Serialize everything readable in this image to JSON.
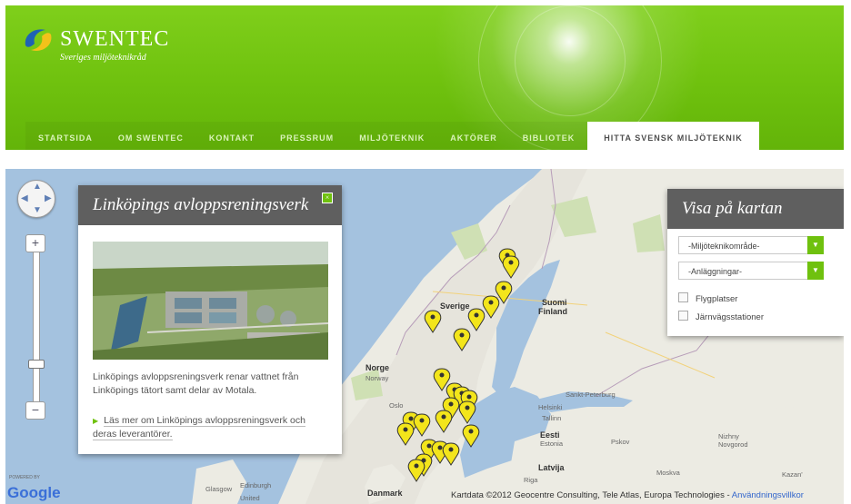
{
  "brand": {
    "name": "SWENTEC",
    "tagline": "Sveriges miljöteknikråd",
    "colors": {
      "green": "#6fc10e",
      "panel_gray": "#5f5f5f",
      "logo_blue": "#1e63b4",
      "logo_yellow": "#f2c21a"
    }
  },
  "nav": {
    "items": [
      {
        "label": "STARTSIDA"
      },
      {
        "label": "OM SWENTEC"
      },
      {
        "label": "KONTAKT"
      },
      {
        "label": "PRESSRUM"
      },
      {
        "label": "MILJÖTEKNIK"
      },
      {
        "label": "AKTÖRER"
      },
      {
        "label": "BIBLIOTEK"
      },
      {
        "label": "HITTA SVENSK MILJÖTEKNIK",
        "active": true
      }
    ]
  },
  "map": {
    "labels": {
      "sverige": "Sverige",
      "suomi": "Suomi",
      "finland": "Finland",
      "norge": "Norge",
      "norway": "Norway",
      "oslo": "Oslo",
      "helsinki": "Helsinki",
      "spb": "Sankt-Peterburg",
      "tallinn": "Tallinn",
      "eesti": "Eesti",
      "estonia": "Estonia",
      "latvija": "Latvija",
      "riga": "Riga",
      "danmark": "Danmark",
      "edinburgh": "Edinburgh",
      "glasgow": "Glasgow",
      "united": "United",
      "moskva": "Moskva",
      "nizhny": "Nizhny Novgorod",
      "kazan": "Kazan'",
      "pskov": "Pskov"
    },
    "google": {
      "powered": "POWERED BY",
      "logo": "Google"
    },
    "attribution": "Kartdata ©2012 Geocentre Consulting, Tele Atlas, Europa Technologies -",
    "attribution_link": "Användningsvillkor"
  },
  "infowindow": {
    "title": "Linköpings avloppsreningsverk",
    "body": "Linköpings avloppsreningsverk renar vattnet från Linköpings tätort samt delar av Motala.",
    "link": "Läs mer om Linköpings avloppsreningsverk och deras leverantörer."
  },
  "filter_panel": {
    "title": "Visa på kartan",
    "select1": "-Miljöteknikområde-",
    "select2": "-Anläggningar-",
    "check1": "Flygplatser",
    "check2": "Järnvägsstationer"
  }
}
